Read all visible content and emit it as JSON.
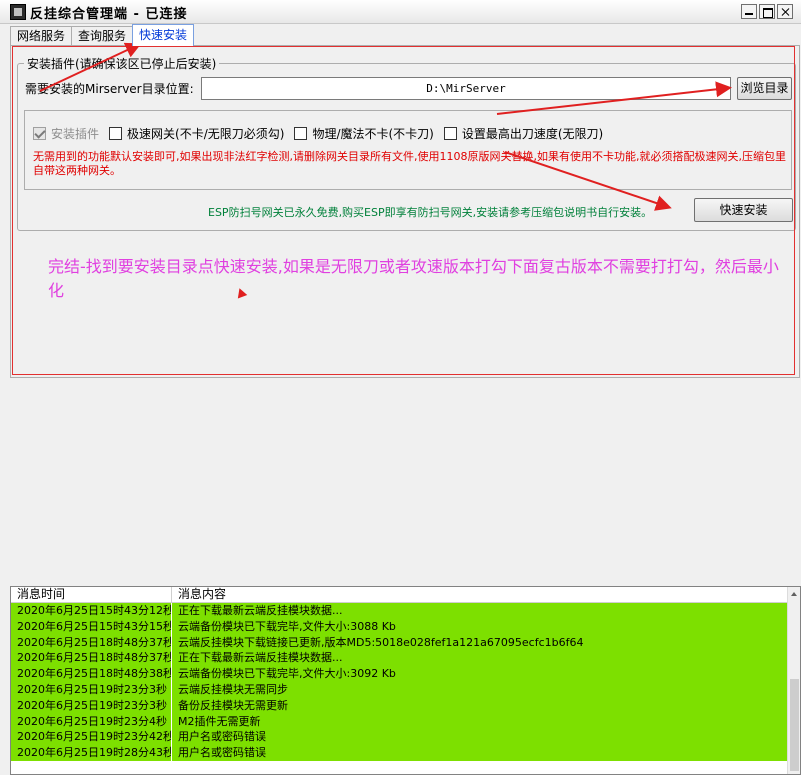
{
  "window": {
    "title": "反挂综合管理端 - 已连接"
  },
  "tabs": [
    {
      "label": "网络服务"
    },
    {
      "label": "查询服务"
    },
    {
      "label": "快速安装"
    }
  ],
  "install": {
    "group_title": "安装插件(请确保该区已停止后安装)",
    "dir_label": "需要安装的Mirserver目录位置:",
    "dir_value": "D:\\MirServer",
    "browse_label": "浏览目录",
    "options": [
      {
        "label": "安装插件",
        "checked": true,
        "disabled": true
      },
      {
        "label": "极速网关(不卡/无限刀必须勾)",
        "checked": false
      },
      {
        "label": "物理/魔法不卡(不卡刀)",
        "checked": false
      },
      {
        "label": "设置最高出刀速度(无限刀)",
        "checked": false
      }
    ],
    "warning": "无需用到的功能默认安装即可,如果出现非法红字检测,请删除网关目录所有文件,使用1108原版网关替换,如果有使用不卡功能,就必须搭配极速网关,压缩包里自带这两种网关。",
    "esp_note": "ESP防扫号网关已永久免费,购买ESP即享有防扫号网关,安装请参考压缩包说明书自行安装。",
    "install_label": "快速安装",
    "note": "完结-找到要安装目录点快速安装,如果是无限刀或者攻速版本打勾下面复古版本不需要打打勾，然后最小化"
  },
  "log": {
    "headers": [
      "消息时间",
      "消息内容"
    ],
    "rows": [
      [
        "2020年6月25日15时43分12秒",
        "正在下载最新云端反挂模块数据..."
      ],
      [
        "2020年6月25日15时43分15秒",
        "云端备份模块已下载完毕,文件大小:3088 Kb"
      ],
      [
        "2020年6月25日18时48分37秒",
        "云端反挂模块下载链接已更新,版本MD5:5018e028fef1a121a67095ecfc1b6f64"
      ],
      [
        "2020年6月25日18时48分37秒",
        "正在下载最新云端反挂模块数据..."
      ],
      [
        "2020年6月25日18时48分38秒",
        "云端备份模块已下载完毕,文件大小:3092 Kb"
      ],
      [
        "2020年6月25日19时23分3秒",
        "云端反挂模块无需同步"
      ],
      [
        "2020年6月25日19时23分3秒",
        "备份反挂模块无需更新"
      ],
      [
        "2020年6月25日19时23分4秒",
        "M2插件无需更新"
      ],
      [
        "2020年6月25日19时23分42秒",
        "用户名或密码错误"
      ],
      [
        "2020年6月25日19时28分43秒",
        "用户名或密码错误"
      ]
    ],
    "row_color": "#7de000"
  },
  "colors": {
    "annotation_arrow": "#e02020",
    "note_text": "#e040e0",
    "warning_text": "#e00000",
    "esp_text": "#00803a"
  }
}
